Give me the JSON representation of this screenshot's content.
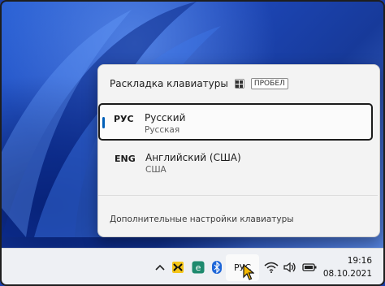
{
  "flyout": {
    "title": "Раскладка клавиатуры",
    "shortcut_key": "ПРОБЕЛ",
    "languages": [
      {
        "code": "РУС",
        "name": "Русский",
        "layout": "Русская",
        "selected": true
      },
      {
        "code": "ENG",
        "name": "Английский (США)",
        "layout": "США",
        "selected": false
      }
    ],
    "more_settings": "Дополнительные настройки клавиатуры"
  },
  "taskbar": {
    "language_indicator": "РУС",
    "clock_time": "19:16",
    "clock_date": "08.10.2021",
    "tray_icons": [
      "chevron-up-icon",
      "tray-app-icon",
      "edge-icon",
      "bluetooth-icon",
      "wifi-icon",
      "volume-icon",
      "battery-icon"
    ]
  },
  "colors": {
    "accent": "#005fb8",
    "wallpaper": "#1d47b8",
    "flyout_bg": "#f3f3f3",
    "taskbar_bg": "#eef0f4"
  }
}
